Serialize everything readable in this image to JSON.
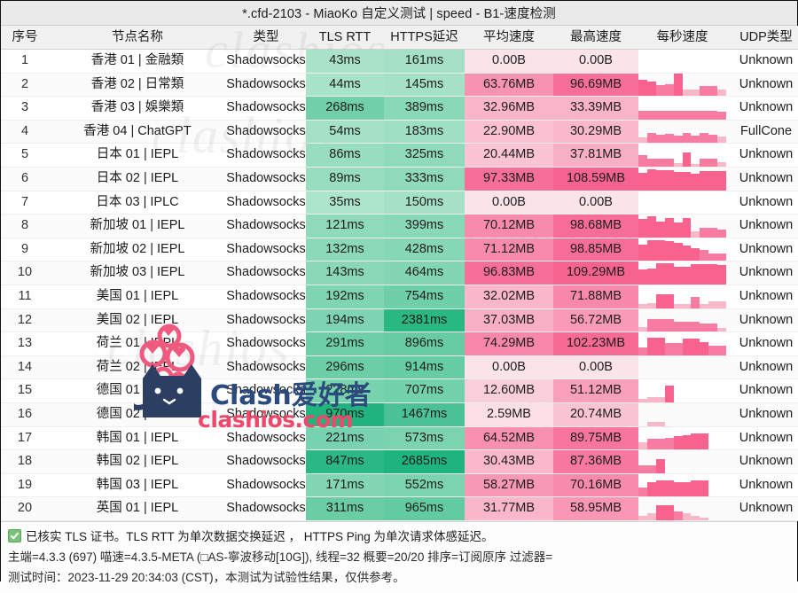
{
  "window": {
    "title": "*.cfd-2103 - MiaoKo 自定义测试 | speed - B1-速度检测"
  },
  "table": {
    "columns": [
      "序号",
      "节点名称",
      "类型",
      "TLS RTT",
      "HTTPS延迟",
      "平均速度",
      "最高速度",
      "每秒速度",
      "UDP类型"
    ],
    "rows": [
      {
        "idx": "1",
        "name": "香港 01 | 金融類",
        "type": "Shadowsocks",
        "tls": "43ms",
        "tls_v": 43,
        "https": "161ms",
        "https_v": 161,
        "avg": "0.00B",
        "avg_v": 0,
        "max": "0.00B",
        "max_v": 0,
        "spark": [],
        "udp": "Unknown"
      },
      {
        "idx": "2",
        "name": "香港 02 | 日常類",
        "type": "Shadowsocks",
        "tls": "44ms",
        "tls_v": 44,
        "https": "145ms",
        "https_v": 145,
        "avg": "63.76MB",
        "avg_v": 63.76,
        "max": "96.69MB",
        "max_v": 96.69,
        "spark": [
          72,
          62,
          46,
          50,
          100,
          28,
          28,
          44,
          44,
          30
        ],
        "udp": "Unknown"
      },
      {
        "idx": "3",
        "name": "香港 03 | 娛樂類",
        "type": "Shadowsocks",
        "tls": "268ms",
        "tls_v": 268,
        "https": "389ms",
        "https_v": 389,
        "avg": "32.96MB",
        "avg_v": 32.96,
        "max": "33.39MB",
        "max_v": 33.39,
        "spark": [
          40,
          40,
          40,
          40,
          40,
          40,
          40,
          40,
          40,
          34
        ],
        "udp": "Unknown"
      },
      {
        "idx": "4",
        "name": "香港 04 | ChatGPT",
        "type": "Shadowsocks",
        "tls": "54ms",
        "tls_v": 54,
        "https": "183ms",
        "https_v": 183,
        "avg": "22.90MB",
        "avg_v": 22.9,
        "max": "30.29MB",
        "max_v": 30.29,
        "spark": [
          26,
          46,
          36,
          42,
          34,
          46,
          34,
          46,
          38,
          30
        ],
        "udp": "FullCone"
      },
      {
        "idx": "5",
        "name": "日本 01 | IEPL",
        "type": "Shadowsocks",
        "tls": "86ms",
        "tls_v": 86,
        "https": "325ms",
        "https_v": 325,
        "avg": "20.44MB",
        "avg_v": 20.44,
        "max": "37.81MB",
        "max_v": 37.81,
        "spark": [
          52,
          36,
          36,
          36,
          16,
          62,
          12,
          34,
          34,
          20
        ],
        "udp": "Unknown"
      },
      {
        "idx": "6",
        "name": "日本 02 | IEPL",
        "type": "Shadowsocks",
        "tls": "89ms",
        "tls_v": 89,
        "https": "333ms",
        "https_v": 333,
        "avg": "97.33MB",
        "avg_v": 97.33,
        "max": "108.59MB",
        "max_v": 108.59,
        "spark": [
          78,
          94,
          90,
          90,
          82,
          82,
          72,
          84,
          84,
          84
        ],
        "udp": "Unknown"
      },
      {
        "idx": "7",
        "name": "日本 03 | IPLC",
        "type": "Shadowsocks",
        "tls": "35ms",
        "tls_v": 35,
        "https": "150ms",
        "https_v": 150,
        "avg": "0.00B",
        "avg_v": 0,
        "max": "0.00B",
        "max_v": 0,
        "spark": [],
        "udp": "Unknown"
      },
      {
        "idx": "8",
        "name": "新加坡 01 | IEPL",
        "type": "Shadowsocks",
        "tls": "121ms",
        "tls_v": 121,
        "https": "399ms",
        "https_v": 399,
        "avg": "70.12MB",
        "avg_v": 70.12,
        "max": "98.68MB",
        "max_v": 98.68,
        "spark": [
          80,
          92,
          70,
          84,
          64,
          86,
          26,
          42,
          42,
          34
        ],
        "udp": "Unknown"
      },
      {
        "idx": "9",
        "name": "新加坡 02 | IEPL",
        "type": "Shadowsocks",
        "tls": "132ms",
        "tls_v": 132,
        "https": "428ms",
        "https_v": 428,
        "avg": "71.12MB",
        "avg_v": 71.12,
        "max": "98.85MB",
        "max_v": 98.85,
        "spark": [
          70,
          92,
          92,
          86,
          78,
          66,
          56,
          50,
          34,
          34
        ],
        "udp": "Unknown"
      },
      {
        "idx": "10",
        "name": "新加坡 03 | IEPL",
        "type": "Shadowsocks",
        "tls": "143ms",
        "tls_v": 143,
        "https": "464ms",
        "https_v": 464,
        "avg": "96.83MB",
        "avg_v": 96.83,
        "max": "109.29MB",
        "max_v": 109.29,
        "spark": [
          66,
          72,
          92,
          92,
          78,
          78,
          90,
          90,
          90,
          86
        ],
        "udp": "Unknown"
      },
      {
        "idx": "11",
        "name": "美国 01 | IEPL",
        "type": "Shadowsocks",
        "tls": "192ms",
        "tls_v": 192,
        "https": "754ms",
        "https_v": 754,
        "avg": "32.02MB",
        "avg_v": 32.02,
        "max": "71.88MB",
        "max_v": 71.88,
        "spark": [
          16,
          20,
          62,
          62,
          16,
          16,
          48,
          18,
          30,
          30
        ],
        "udp": "Unknown"
      },
      {
        "idx": "12",
        "name": "美国 02 | IEPL",
        "type": "Shadowsocks",
        "tls": "194ms",
        "tls_v": 194,
        "https": "2381ms",
        "https_v": 2381,
        "avg": "37.03MB",
        "avg_v": 37.03,
        "max": "56.72MB",
        "max_v": 56.72,
        "spark": [
          22,
          54,
          54,
          54,
          42,
          42,
          42,
          34,
          34,
          18
        ],
        "udp": "Unknown"
      },
      {
        "idx": "13",
        "name": "荷兰 01 | IEPL",
        "type": "Shadowsocks",
        "tls": "291ms",
        "tls_v": 291,
        "https": "896ms",
        "https_v": 896,
        "avg": "74.29MB",
        "avg_v": 74.29,
        "max": "102.23MB",
        "max_v": 102.23,
        "spark": [
          36,
          76,
          76,
          52,
          52,
          74,
          74,
          56,
          40,
          40
        ],
        "udp": "Unknown"
      },
      {
        "idx": "14",
        "name": "荷兰 02 | IEPL",
        "type": "Shadowsocks",
        "tls": "296ms",
        "tls_v": 296,
        "https": "914ms",
        "https_v": 914,
        "avg": "0.00B",
        "avg_v": 0,
        "max": "0.00B",
        "max_v": 0,
        "spark": [],
        "udp": "Unknown"
      },
      {
        "idx": "15",
        "name": "德国 01 | IEPL",
        "type": "Shadowsocks",
        "tls": "228ms",
        "tls_v": 228,
        "https": "707ms",
        "https_v": 707,
        "avg": "12.60MB",
        "avg_v": 12.6,
        "max": "51.12MB",
        "max_v": 51.12,
        "spark": [
          14,
          22,
          22,
          72,
          0,
          0,
          0,
          0,
          0,
          0
        ],
        "udp": "Unknown"
      },
      {
        "idx": "16",
        "name": "德国 02 | IEPL",
        "type": "Shadowsocks",
        "tls": "970ms",
        "tls_v": 970,
        "https": "1467ms",
        "https_v": 1467,
        "avg": "2.59MB",
        "avg_v": 2.59,
        "max": "20.74MB",
        "max_v": 20.74,
        "spark": [
          0,
          16,
          16,
          0,
          0,
          0,
          0,
          0,
          0,
          0
        ],
        "udp": "Unknown"
      },
      {
        "idx": "17",
        "name": "韩国 01 | IEPL",
        "type": "Shadowsocks",
        "tls": "221ms",
        "tls_v": 221,
        "https": "573ms",
        "https_v": 573,
        "avg": "64.52MB",
        "avg_v": 64.52,
        "max": "89.75MB",
        "max_v": 89.75,
        "spark": [
          30,
          46,
          46,
          50,
          58,
          62,
          72,
          72,
          0,
          0
        ],
        "udp": "Unknown"
      },
      {
        "idx": "18",
        "name": "韩国 02 | IEPL",
        "type": "Shadowsocks",
        "tls": "847ms",
        "tls_v": 847,
        "https": "2685ms",
        "https_v": 2685,
        "avg": "30.43MB",
        "avg_v": 30.43,
        "max": "87.36MB",
        "max_v": 87.36,
        "spark": [
          34,
          34,
          60,
          0,
          0,
          0,
          0,
          0,
          0,
          0
        ],
        "udp": "Unknown"
      },
      {
        "idx": "19",
        "name": "韩国 03 | IEPL",
        "type": "Shadowsocks",
        "tls": "171ms",
        "tls_v": 171,
        "https": "552ms",
        "https_v": 552,
        "avg": "58.27MB",
        "avg_v": 58.27,
        "max": "70.16MB",
        "max_v": 70.16,
        "spark": [
          40,
          62,
          70,
          70,
          64,
          64,
          70,
          70,
          0,
          0
        ],
        "udp": "Unknown"
      },
      {
        "idx": "20",
        "name": "英国 01 | IEPL",
        "type": "Shadowsocks",
        "tls": "311ms",
        "tls_v": 311,
        "https": "965ms",
        "https_v": 965,
        "avg": "31.77MB",
        "avg_v": 31.77,
        "max": "58.95MB",
        "max_v": 58.95,
        "spark": [
          18,
          30,
          66,
          66,
          40,
          30,
          18,
          12,
          0,
          0
        ],
        "udp": "Unknown"
      }
    ]
  },
  "footer": {
    "line1": "已核实 TLS 证书。TLS RTT 为单次数据交换延迟 ，  HTTPS Ping 为单次请求体感延迟。",
    "line2": "主端=4.3.3 (697) 喵速=4.3.5-META (□AS-寧波移动[10G]), 线程=32 概要=20/20 排序=订阅原序 过滤器=",
    "line3": "测试时间：2023-11-29 20:34:03 (CST)，本测试为试验性结果，仅供参考。"
  },
  "watermark": {
    "ghost_text": "clashios",
    "brand": "Clash爱好者",
    "site": "clashios.com"
  },
  "colors": {
    "latency_low": "#d6f2e2",
    "latency_high": "#0fae74",
    "speed_low": "#fbe3ea",
    "speed_high": "#f7628f",
    "spark_bar": "#f8a8bd",
    "titlebar_bg": "#eaeaea",
    "header_bg": "#f1f1f1",
    "check_green": "#78c27a"
  }
}
